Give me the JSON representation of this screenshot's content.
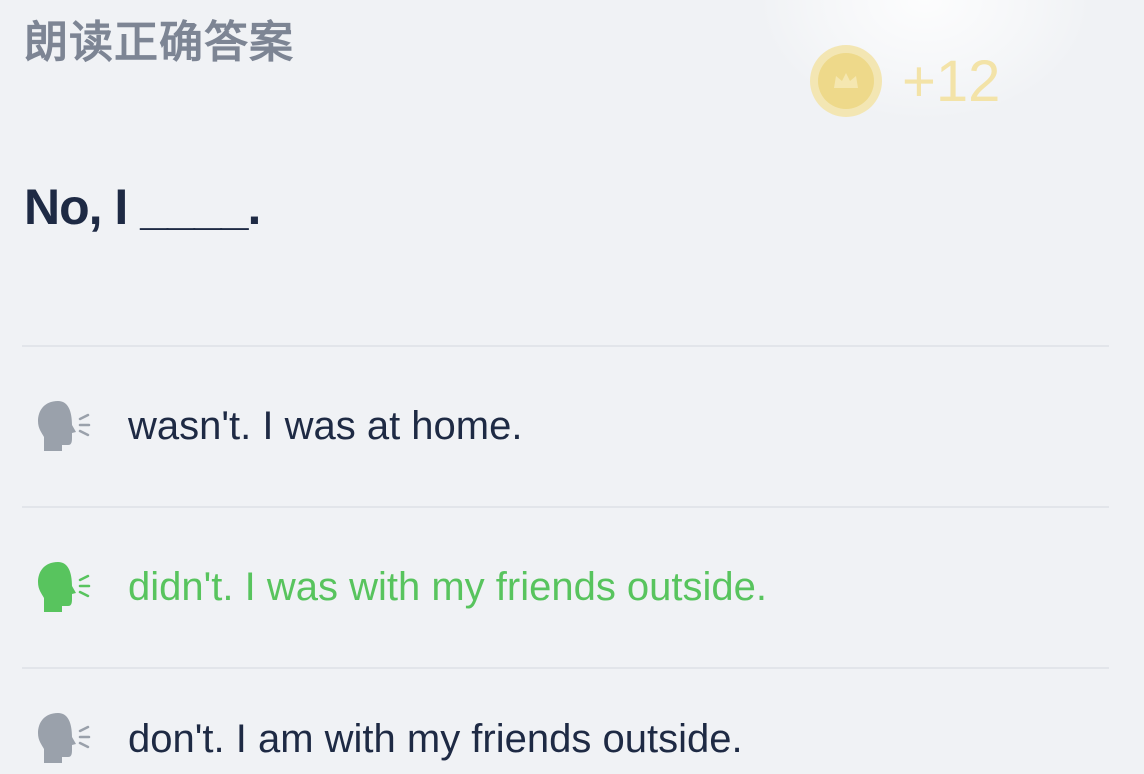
{
  "header": {
    "title": "朗读正确答案"
  },
  "reward": {
    "icon": "crown-coin-icon",
    "points_text": "+12"
  },
  "question": {
    "text": "No, I ____."
  },
  "options": [
    {
      "label": "wasn't. I was at home.",
      "icon": "speaking-head-icon",
      "state": "default",
      "icon_color": "#9aa1ab"
    },
    {
      "label": "didn't. I was with my friends outside.",
      "icon": "speaking-head-icon",
      "state": "correct",
      "icon_color": "#58c45e"
    },
    {
      "label": "don't. I am with my friends outside.",
      "icon": "speaking-head-icon",
      "state": "default",
      "icon_color": "#9aa1ab"
    }
  ],
  "colors": {
    "background": "#f0f2f5",
    "text": "#1e2a44",
    "correct": "#58c45e",
    "muted_icon": "#9aa1ab",
    "coin": "#eed98a"
  }
}
